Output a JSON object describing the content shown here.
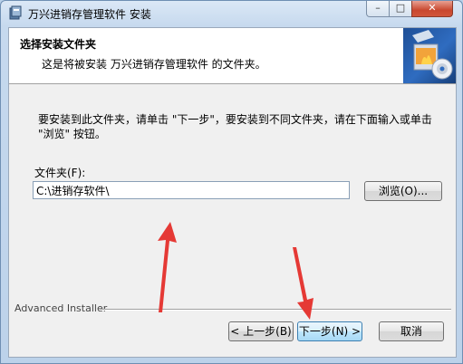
{
  "window": {
    "title": "万兴进销存管理软件 安装",
    "controls": {
      "minimize": "–",
      "maximize": "□",
      "close": "✕"
    }
  },
  "header": {
    "title": "选择安装文件夹",
    "subtitle": "这是将被安装 万兴进销存管理软件 的文件夹。"
  },
  "body": {
    "instruction": "要安装到此文件夹，请单击 \"下一步\"，要安装到不同文件夹，请在下面输入或单击 \"浏览\" 按钮。",
    "folder_label": "文件夹(F):",
    "folder_value": "C:\\进销存软件\\",
    "browse_label": "浏览(O)..."
  },
  "footer": {
    "brand": "Advanced Installer",
    "back_label": "< 上一步(B)",
    "next_label": "下一步(N) >",
    "cancel_label": "取消"
  },
  "colors": {
    "annotation_arrow": "#e53935",
    "window_frame": "#bcd2ea",
    "close_button": "#c9482f"
  }
}
